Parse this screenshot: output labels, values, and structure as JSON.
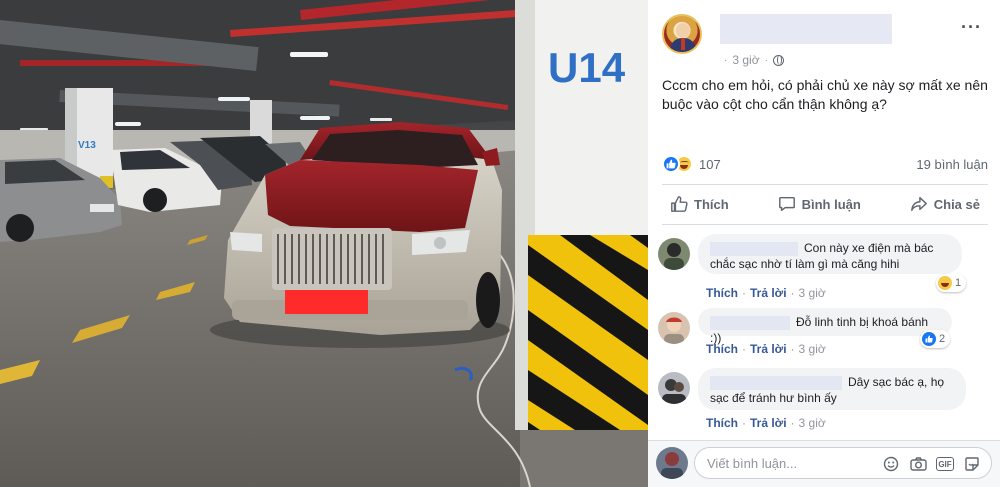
{
  "photo": {
    "pillar_label": "U14",
    "left_pillar_label": "V13",
    "plate_text": ""
  },
  "post": {
    "time": "3 giờ",
    "text": "Cccm cho em hỏi, có phải chủ xe này sợ mất xe nên buộc vào cột cho cẩn thận không ạ?",
    "reactions_count": "107",
    "comments_count": "19 bình luận",
    "actions": {
      "like": "Thích",
      "comment": "Bình luận",
      "share": "Chia sẻ"
    }
  },
  "comments": [
    {
      "text": "Con này xe điện mà bác chắc sạc nhờ tí làm gì mà căng hihi",
      "reaction_count": "1",
      "reaction": "haha-icon",
      "like_label": "Thích",
      "reply_label": "Trả lời",
      "time": "3 giờ"
    },
    {
      "text": "Đỗ linh tinh bị khoá bánh :))",
      "reaction_count": "2",
      "reaction": "like-icon",
      "like_label": "Thích",
      "reply_label": "Trả lời",
      "time": "3 giờ"
    },
    {
      "text": "Dây sạc bác ạ, họ sạc để tránh hư bình ấy",
      "like_label": "Thích",
      "reply_label": "Trả lời",
      "time": "3 giờ"
    }
  ],
  "composer": {
    "placeholder": "Viết bình luận...",
    "icons": [
      "emoji-icon",
      "camera-icon",
      "gif-icon",
      "sticker-icon"
    ]
  },
  "colors": {
    "link": "#385898",
    "muted": "#90949c",
    "bubble": "#f2f3f5",
    "like_blue": "#1877f2",
    "car_red": "#8e1b1f",
    "redaction": "#ff2a2a"
  }
}
